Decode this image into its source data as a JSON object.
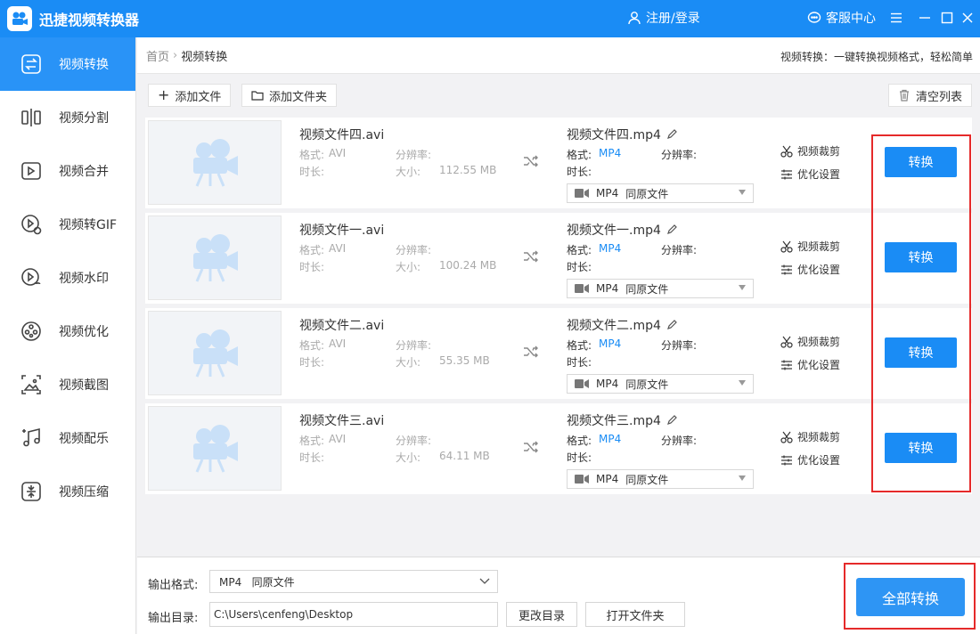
{
  "app": {
    "title": "迅捷视频转换器",
    "login": "注册/登录",
    "service": "客服中心"
  },
  "sidebar": {
    "items": [
      {
        "label": "视频转换",
        "icon": "convert-icon"
      },
      {
        "label": "视频分割",
        "icon": "split-icon"
      },
      {
        "label": "视频合并",
        "icon": "merge-icon"
      },
      {
        "label": "视频转GIF",
        "icon": "gif-icon"
      },
      {
        "label": "视频水印",
        "icon": "watermark-icon"
      },
      {
        "label": "视频优化",
        "icon": "optimize-icon"
      },
      {
        "label": "视频截图",
        "icon": "screenshot-icon"
      },
      {
        "label": "视频配乐",
        "icon": "music-icon"
      },
      {
        "label": "视频压缩",
        "icon": "compress-icon"
      }
    ]
  },
  "breadcrumb": {
    "home": "首页",
    "current": "视频转换"
  },
  "tagline": "视频转换：一键转换视频格式，轻松简单",
  "toolbar": {
    "add_file": "添加文件",
    "add_folder": "添加文件夹",
    "clear_list": "清空列表"
  },
  "labels": {
    "format": "格式:",
    "duration": "时长:",
    "resolution": "分辨率:",
    "size": "大小:",
    "crop": "视频裁剪",
    "optimize": "优化设置",
    "convert": "转换"
  },
  "files": [
    {
      "src_name": "视频文件四.avi",
      "src_format": "AVI",
      "size": "112.55 MB",
      "dst_name": "视频文件四.mp4",
      "dst_format": "MP4",
      "select_format": "MP4",
      "select_quality": "同原文件"
    },
    {
      "src_name": "视频文件一.avi",
      "src_format": "AVI",
      "size": "100.24 MB",
      "dst_name": "视频文件一.mp4",
      "dst_format": "MP4",
      "select_format": "MP4",
      "select_quality": "同原文件"
    },
    {
      "src_name": "视频文件二.avi",
      "src_format": "AVI",
      "size": "55.35 MB",
      "dst_name": "视频文件二.mp4",
      "dst_format": "MP4",
      "select_format": "MP4",
      "select_quality": "同原文件"
    },
    {
      "src_name": "视频文件三.avi",
      "src_format": "AVI",
      "size": "64.11 MB",
      "dst_name": "视频文件三.mp4",
      "dst_format": "MP4",
      "select_format": "MP4",
      "select_quality": "同原文件"
    }
  ],
  "footer": {
    "output_format_label": "输出格式:",
    "output_format_value": "MP4   同原文件",
    "output_dir_label": "输出目录:",
    "output_dir_value": "C:\\Users\\cenfeng\\Desktop",
    "change_dir": "更改目录",
    "open_folder": "打开文件夹",
    "convert_all": "全部转换"
  },
  "colors": {
    "accent": "#1a8cf5",
    "highlight": "#e52a2a"
  }
}
